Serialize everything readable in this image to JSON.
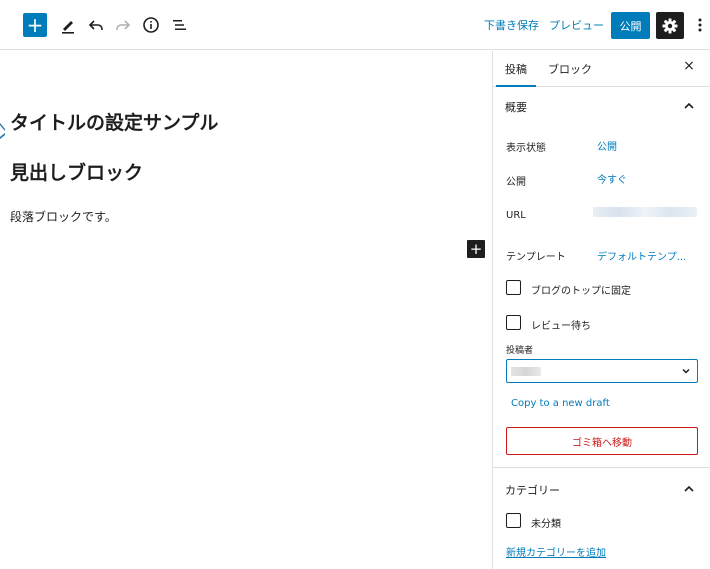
{
  "toolbar": {
    "add_symbol": "+",
    "save_draft": "下書き保存",
    "preview": "プレビュー",
    "publish": "公開"
  },
  "editor": {
    "post_title": "タイトルの設定サンプル",
    "heading": "見出しブロック",
    "paragraph": "段落ブロックです。",
    "inline_add_symbol": "+"
  },
  "sidebar": {
    "tabs": [
      "投稿",
      "ブロック"
    ],
    "close_symbol": "×",
    "summary_panel": {
      "title": "概要",
      "rows": [
        {
          "label": "表示状態",
          "value": "公開"
        },
        {
          "label": "公開",
          "value": "今すぐ"
        },
        {
          "label": "URL",
          "value": ""
        },
        {
          "label": "テンプレート",
          "value": "デフォルトテンプ..."
        }
      ],
      "checkboxes": [
        "ブログのトップに固定",
        "レビュー待ち"
      ],
      "author_label": "投稿者",
      "copy_draft": "Copy to a new draft",
      "trash": "ゴミ箱へ移動"
    },
    "category_panel": {
      "title": "カテゴリー",
      "checkboxes": [
        "未分類"
      ],
      "add_new": "新規カテゴリーを追加"
    }
  },
  "colors": {
    "accent": "#007cba",
    "danger": "#cc1818",
    "dark": "#1e1e1e",
    "border": "#e0e0e0"
  }
}
